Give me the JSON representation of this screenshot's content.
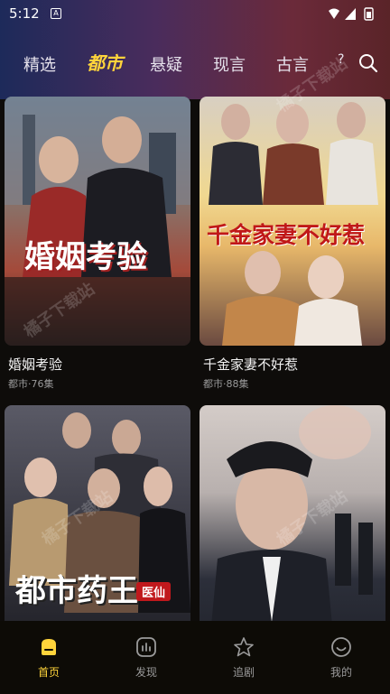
{
  "status": {
    "time": "5:12",
    "notif_icon": "A"
  },
  "tabs": [
    {
      "label": "精选"
    },
    {
      "label": "都市"
    },
    {
      "label": "悬疑"
    },
    {
      "label": "现言"
    },
    {
      "label": "古言"
    }
  ],
  "tab_more": "?",
  "cards": [
    {
      "title": "婚姻考验",
      "meta": "都市·76集",
      "poster_text": "婚姻考验",
      "poster_colors": [
        "#6d7c8d",
        "#a44a3a",
        "#2a2a2a"
      ]
    },
    {
      "title": "千金家妻不好惹",
      "meta": "都市·88集",
      "poster_text": "千金家妻不好惹",
      "poster_colors": [
        "#e8c77a",
        "#b87a4a",
        "#6a4030"
      ]
    },
    {
      "title": "",
      "meta": "",
      "poster_text": "都市药王",
      "poster_badge": "医仙",
      "poster_colors": [
        "#3a3a44",
        "#6a5a52",
        "#1e1e24"
      ]
    },
    {
      "title": "",
      "meta": "",
      "poster_text": "",
      "poster_colors": [
        "#c9c3c0",
        "#2c2f3a",
        "#7a6a6a"
      ]
    }
  ],
  "watermark": "橘子下载站",
  "nav": [
    {
      "label": "首页",
      "icon": "home-icon"
    },
    {
      "label": "发现",
      "icon": "discover-icon"
    },
    {
      "label": "追剧",
      "icon": "star-icon"
    },
    {
      "label": "我的",
      "icon": "profile-icon"
    }
  ],
  "colors": {
    "accent": "#ffd43b",
    "muted": "#9a9a9a"
  }
}
